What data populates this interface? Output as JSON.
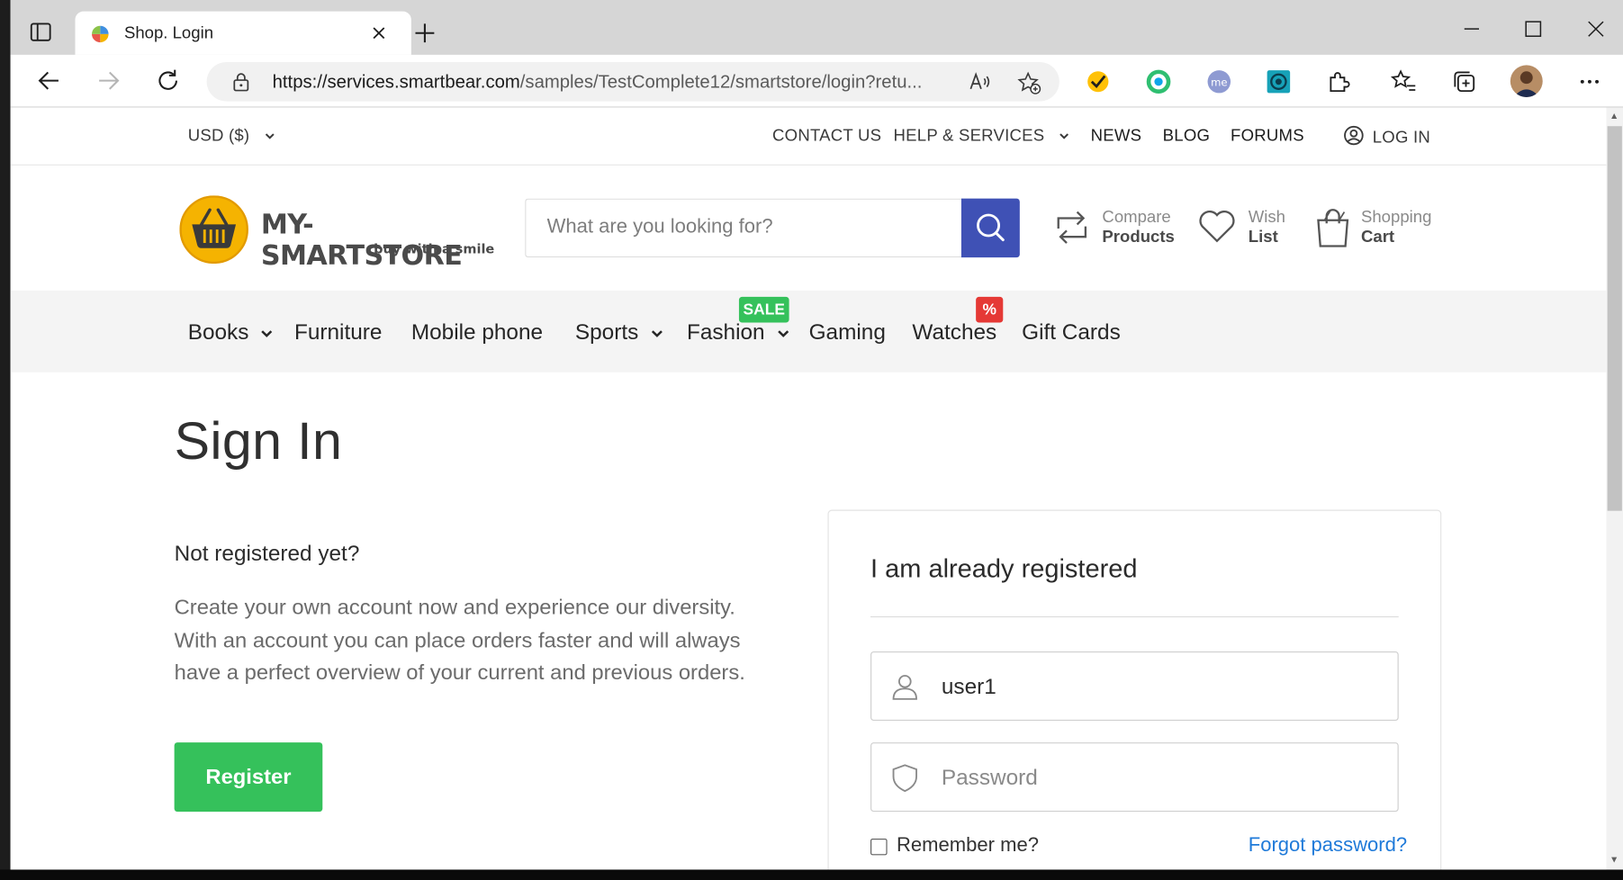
{
  "browser": {
    "tab_title": "Shop. Login",
    "url_host": "https://services.smartbear.com",
    "url_path": "/samples/TestComplete12/smartstore/login?retu...",
    "extensions": [
      "norton-icon",
      "extension-green-icon",
      "me-extension-icon",
      "extension-teal-icon"
    ]
  },
  "utility_bar": {
    "currency": "USD  ($)",
    "contact": "CONTACT US",
    "help": "HELP & SERVICES",
    "news": "NEWS",
    "blog": "BLOG",
    "forums": "FORUMS",
    "login": "LOG IN"
  },
  "header": {
    "logo_name": "MY-SMARTSTORE",
    "logo_tagline": "buy with a smile",
    "search_placeholder": "What are you looking for?",
    "compare_small": "Compare",
    "compare_big": "Products",
    "wish_small": "Wish",
    "wish_big": "List",
    "cart_small": "Shopping",
    "cart_big": "Cart"
  },
  "categories": {
    "books": "Books",
    "furniture": "Furniture",
    "mobile": "Mobile phone",
    "sports": "Sports",
    "fashion": "Fashion",
    "fashion_badge": "SALE",
    "gaming": "Gaming",
    "watches": "Watches",
    "watches_badge": "%",
    "gift_cards": "Gift Cards"
  },
  "colors": {
    "accent_blue": "#3f51b5",
    "register_green": "#35c15b",
    "sale_badge": "#35c15b",
    "percent_badge": "#e53935",
    "link_blue": "#1f7ad9"
  },
  "signin": {
    "title": "Sign In",
    "not_registered": "Not registered yet?",
    "register_text": "Create your own account now and experience our diversity. With an account you can place orders faster and will always have a perfect overview of your current and previous orders.",
    "register_button": "Register",
    "login_title": "I am already registered",
    "username_value": "user1",
    "password_placeholder": "Password",
    "remember_label": "Remember me?",
    "forgot_password": "Forgot password?"
  }
}
